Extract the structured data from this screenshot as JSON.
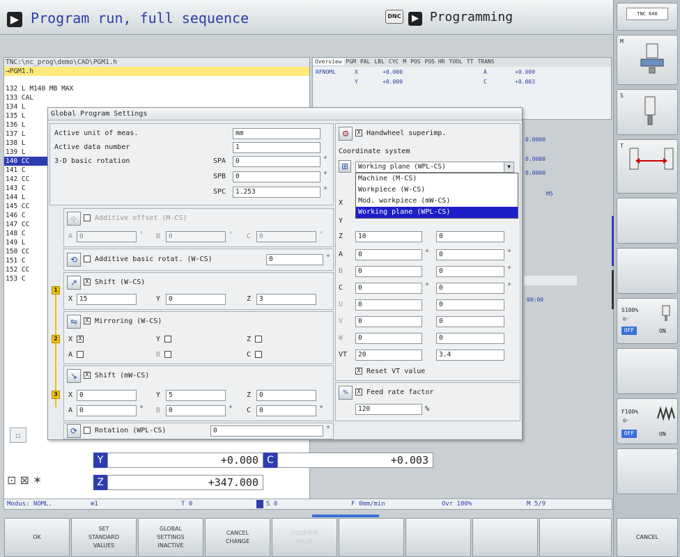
{
  "header": {
    "mode_primary": "Program run, full sequence",
    "dnc_label": "DNC",
    "mode_secondary": "Programming"
  },
  "right_bar": {
    "logo": "TNC 640",
    "m_label": "M",
    "s_label": "S",
    "t_label": "T",
    "s_override": "S100%",
    "s_off": "OFF",
    "s_on": "ON",
    "f_override": "F100%",
    "f_off": "OFF",
    "f_on": "ON"
  },
  "program": {
    "path": "TNC:\\nc_prog\\demo\\CAD\\PGM1.h",
    "selected_file": "→PGM1.h",
    "lines": [
      "132 L M140 MB MAX",
      "133 CAL",
      "134 L",
      "135 L",
      "136 L",
      "137 L",
      "138 L",
      "139 L",
      "140 CC",
      "141 C",
      "142 CC",
      "143 C",
      "144 L",
      "145 CC",
      "146 C",
      "147 CC",
      "148 C",
      "149 L",
      "150 CC",
      "151 C",
      "152 CC",
      "153 C"
    ],
    "highlight_index": 8
  },
  "overview": {
    "tabs": [
      "Overview",
      "PGM",
      "PAL",
      "LBL",
      "CYC",
      "M",
      "POS",
      "POS HR",
      "TOOL",
      "TT",
      "TRANS"
    ],
    "rfnoml": "RFNOML",
    "x_label": "X",
    "x_value": "+0.000",
    "y_label": "Y",
    "y_value": "+0.000",
    "a_label": "A",
    "a_value": "+0.000",
    "c_label": "C",
    "c_value": "+0.003",
    "extra_values": [
      "0.0000",
      "0.0000",
      "0.0000"
    ],
    "m5": "M5",
    "time": "00:00"
  },
  "dialog": {
    "title": "Global Program Settings",
    "active_unit_label": "Active unit of meas.",
    "active_unit_value": "mm",
    "active_data_label": "Active data number",
    "active_data_value": "1",
    "basic_rot_label": "3-D basic rotation",
    "spa_label": "SPA",
    "spa_value": "0",
    "spb_label": "SPB",
    "spb_value": "0",
    "spc_label": "SPC",
    "spc_value": "1.253",
    "deg": "°",
    "additive_offset_label": "Additive offset (M-CS)",
    "ao_a": "A",
    "ao_a_val": "0",
    "ao_b": "B",
    "ao_b_val": "0",
    "ao_c": "C",
    "ao_c_val": "0",
    "additive_rot_label": "Additive basic rotat. (W-CS)",
    "additive_rot_value": "0",
    "shift_w_label": "Shift (W-CS)",
    "shift_w_x": "X",
    "shift_w_x_val": "15",
    "shift_w_y": "Y",
    "shift_w_y_val": "0",
    "shift_w_z": "Z",
    "shift_w_z_val": "3",
    "mirroring_label": "Mirroring (W-CS)",
    "mir_x": "X",
    "mir_y": "Y",
    "mir_z": "Z",
    "mir_a": "A",
    "mir_b": "B",
    "mir_c": "C",
    "shift_mw_label": "Shift (mW-CS)",
    "smw_x": "X",
    "smw_x_val": "0",
    "smw_y": "Y",
    "smw_y_val": "5",
    "smw_z": "Z",
    "smw_z_val": "0",
    "smw_a": "A",
    "smw_a_val": "0",
    "smw_b": "B",
    "smw_b_val": "0",
    "smw_c": "C",
    "smw_c_val": "0",
    "rotation_label": "Rotation (WPL-CS)",
    "rotation_value": "0",
    "handwheel_label": "Handwheel superimp.",
    "coord_label": "Coordinate system",
    "coord_selected": "Working plane (WPL-CS)",
    "coord_options": [
      "Machine (M-CS)",
      "Workpiece (W-CS)",
      "Mod. workpiece (mW-CS)",
      "Working plane (WPL-CS)"
    ],
    "hw_x": "X",
    "hw_y": "Y",
    "hw_z": "Z",
    "hw_z_val": "10",
    "hw_z_val2": "0",
    "hw_a": "A",
    "hw_b": "B",
    "hw_c": "C",
    "hw_u": "U",
    "hw_v": "V",
    "hw_w": "W",
    "zero": "0",
    "vt_label": "VT",
    "vt_val1": "20",
    "vt_val2": "3.4",
    "reset_vt_label": "Reset VT value",
    "feed_label": "Feed rate factor",
    "feed_value": "120",
    "feed_unit": "%",
    "badge1": "1",
    "badge2": "2",
    "badge3": "3"
  },
  "positions": {
    "y_axis": "Y",
    "y_value": "+0.000",
    "c_axis": "C",
    "c_value": "+0.003",
    "z_axis": "Z",
    "z_value": "+347.000"
  },
  "status": {
    "mode": "Modus: NOML.",
    "tool_num": "1",
    "t_val": "T 0",
    "s_val": "S 0",
    "feed": "F 0mm/min",
    "ovr": "Ovr 100%",
    "m": "M 5/9"
  },
  "softkeys": {
    "ok": "OK",
    "set_standard": "SET\nSTANDARD\nVALUES",
    "global_inactive": "GLOBAL\nSETTINGS\nINACTIVE",
    "cancel_change": "CANCEL\nCHANGE",
    "confirm": "CONFIRM\nVALUE",
    "cancel": "CANCEL"
  }
}
